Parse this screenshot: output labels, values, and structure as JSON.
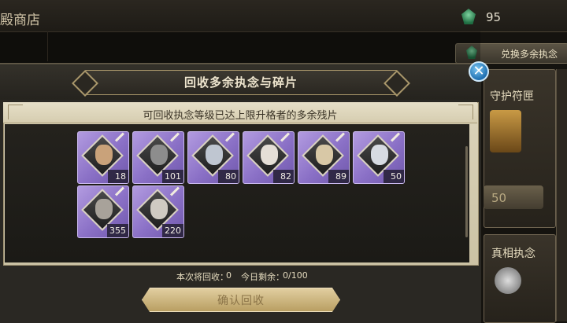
{
  "background": {
    "shop_title": "殿商店",
    "currency_value": "95",
    "exchange_button_label": "兑换多余执念",
    "card_a_title": "守护符匣",
    "card_a_price": "50",
    "card_b_title": "真相执念"
  },
  "dialog": {
    "title": "回收多余执念与碎片",
    "subtitle": "可回收执念等级已达上限升格者的多余残片",
    "items": [
      {
        "count": "18",
        "face": "#c9a27a"
      },
      {
        "count": "101",
        "face": "#8d8d8d"
      },
      {
        "count": "80",
        "face": "#bfc6d1"
      },
      {
        "count": "82",
        "face": "#e5ded6"
      },
      {
        "count": "89",
        "face": "#d8c8a6"
      },
      {
        "count": "50",
        "face": "#d7dbe2"
      },
      {
        "count": "355",
        "face": "#a8a29a"
      },
      {
        "count": "220",
        "face": "#cfcac2"
      }
    ],
    "footer": {
      "recycle_label": "本次将回收：",
      "recycle_value": "0",
      "remaining_label": "今日剩余：",
      "remaining_value": "0/100"
    },
    "confirm_label": "确认回收"
  },
  "colors": {
    "accent_purple": "#8a70c6",
    "close_blue": "#1f6fb0",
    "confirm_gold": "#d1b97f"
  }
}
